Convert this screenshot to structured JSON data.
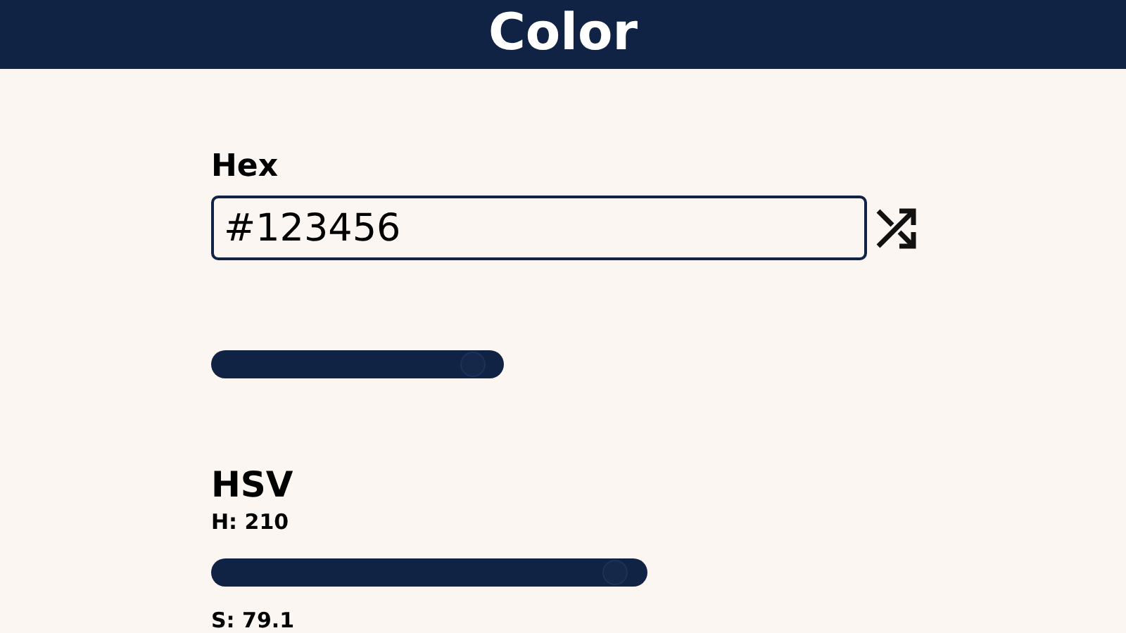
{
  "header": {
    "title": "Color"
  },
  "hex": {
    "label": "Hex",
    "value": "#123456",
    "slider": {
      "level": 0.94
    }
  },
  "hsv": {
    "label": "HSV",
    "channels": [
      {
        "label": "H: 210",
        "level": 0.96
      },
      {
        "label": "S: 79.1"
      }
    ]
  }
}
